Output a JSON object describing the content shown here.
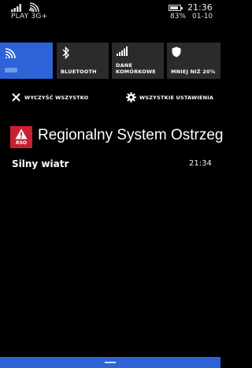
{
  "status_bar": {
    "carrier": "PLAY 3G+",
    "time": "21:36",
    "battery_percent": "83%",
    "battery_level": 0.83,
    "date": "01-10"
  },
  "quick_actions": [
    {
      "label": "",
      "icon": "wifi-icon",
      "active": true
    },
    {
      "label": "BLUETOOTH",
      "icon": "bluetooth-icon",
      "active": false
    },
    {
      "label_line1": "DANE",
      "label_line2": "KOMÓRKOWE",
      "icon": "cellular-icon",
      "active": false
    },
    {
      "label": "MNIEJ NIŻ 20%",
      "icon": "battery-saver-icon",
      "active": false
    }
  ],
  "actions": {
    "clear_all": "WYCZYŚĆ WSZYSTKO",
    "all_settings": "WSZYSTKIE USTAWIENIA"
  },
  "notification": {
    "app_name": "Regionalny System Ostrzeg",
    "app_icon_text": "RSO",
    "title": "Silny wiatr",
    "time": "21:34"
  },
  "colors": {
    "accent": "#2d63d6",
    "tile": "#2b2b2b",
    "app_icon": "#c8202e",
    "background": "#000000"
  }
}
